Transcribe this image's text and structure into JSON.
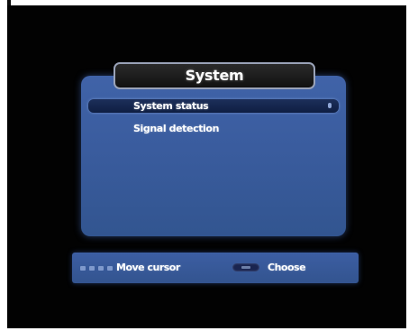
{
  "menu": {
    "title": "System",
    "items": [
      {
        "label": "System status",
        "selected": true
      },
      {
        "label": "Signal detection",
        "selected": false
      }
    ]
  },
  "help_bar": {
    "move_label": "Move cursor",
    "move_icon": "dpad-arrows-icon",
    "choose_label": "Choose",
    "choose_icon": "ok-button-icon"
  },
  "colors": {
    "background": "#020202",
    "panel": "#3a5c9e",
    "selection": "#0f1e42",
    "title_box": "#111111",
    "text": "#ffffff"
  }
}
